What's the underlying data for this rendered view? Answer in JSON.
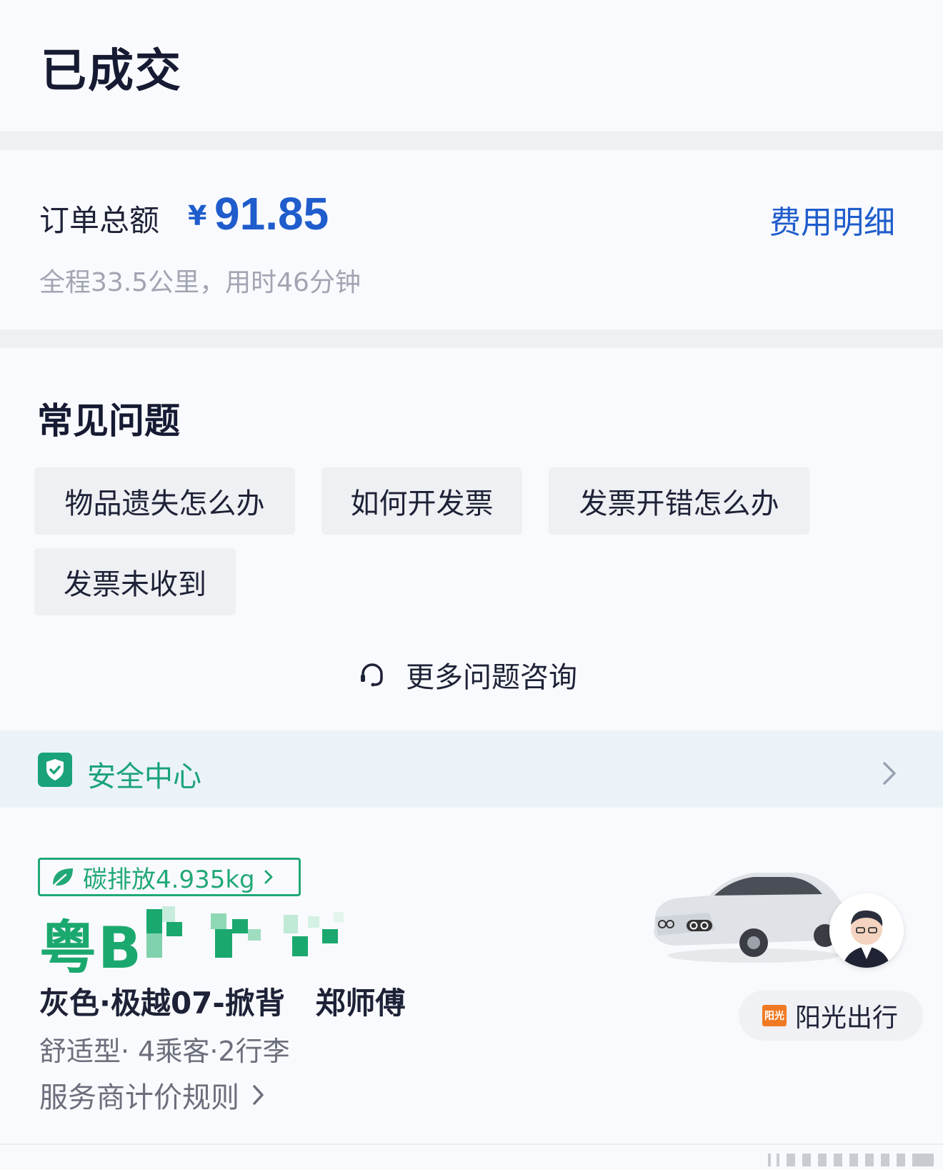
{
  "header": {
    "title": "已成交"
  },
  "order": {
    "label": "订单总额",
    "currency": "¥",
    "amount": "91.85",
    "fee_detail_link": "费用明细",
    "trip_info": "全程33.5公里，用时46分钟"
  },
  "faq": {
    "title": "常见问题",
    "items": [
      "物品遗失怎么办",
      "如何开发票",
      "发票开错怎么办",
      "发票未收到"
    ],
    "more": "更多问题咨询"
  },
  "safety": {
    "label": "安全中心"
  },
  "driver_card": {
    "carbon": "碳排放4.935kg",
    "plate_visible": "粤B",
    "car_desc": "灰色·极越07-掀背",
    "driver_name": "郑师傅",
    "car_spec": "舒适型· 4乘客·2行李",
    "pricing_rule": "服务商计价规则",
    "provider_logo_text": "阳光",
    "provider_name": "阳光出行"
  },
  "colors": {
    "accent_blue": "#1f5ccc",
    "accent_green": "#22a877",
    "provider_orange": "#f07a23"
  }
}
